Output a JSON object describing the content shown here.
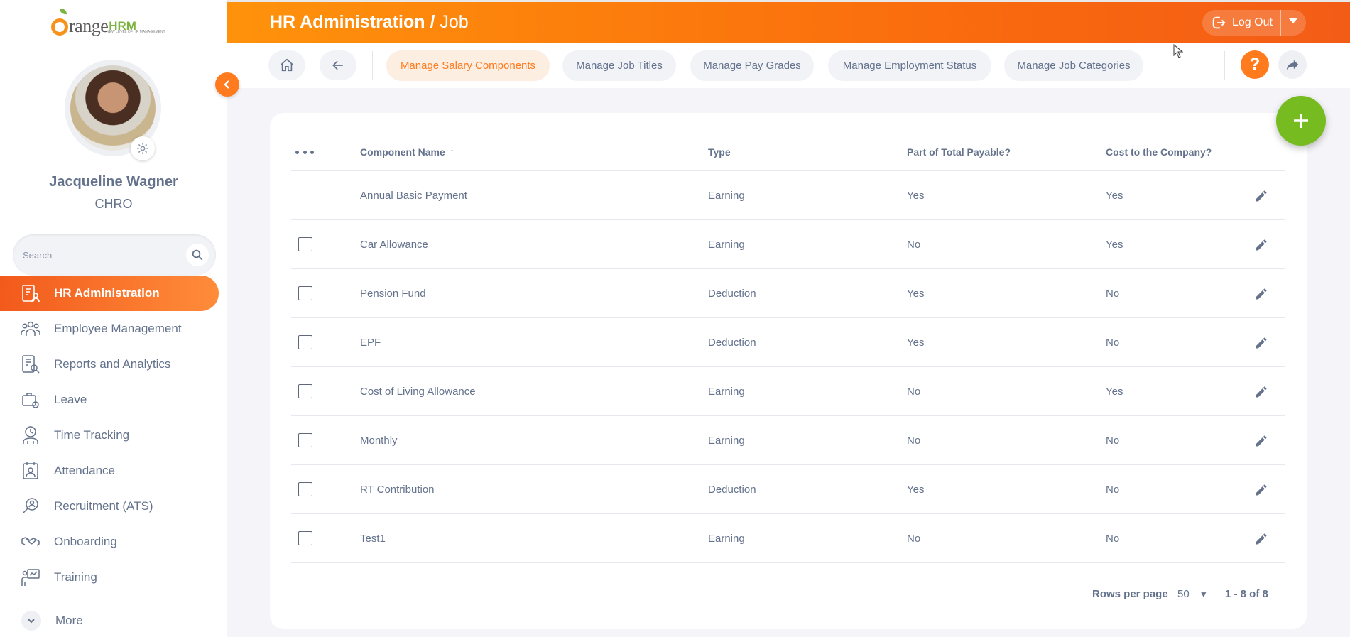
{
  "brand": {
    "logo_orange": "range",
    "logo_hrm": "HRM",
    "tagline": "NEW LEVEL OF HR MANAGEMENT"
  },
  "user": {
    "name": "Jacqueline Wagner",
    "role": "CHRO"
  },
  "search": {
    "placeholder": "Search"
  },
  "nav": {
    "items": [
      {
        "label": "HR Administration",
        "icon": "hr-admin-icon",
        "active": true
      },
      {
        "label": "Employee Management",
        "icon": "employee-icon"
      },
      {
        "label": "Reports and Analytics",
        "icon": "reports-icon"
      },
      {
        "label": "Leave",
        "icon": "leave-icon"
      },
      {
        "label": "Time Tracking",
        "icon": "time-tracking-icon"
      },
      {
        "label": "Attendance",
        "icon": "attendance-icon"
      },
      {
        "label": "Recruitment (ATS)",
        "icon": "recruitment-icon"
      },
      {
        "label": "Onboarding",
        "icon": "onboarding-icon"
      },
      {
        "label": "Training",
        "icon": "training-icon"
      }
    ],
    "more": "More"
  },
  "header": {
    "title_main": "HR Administration / ",
    "title_sub": "Job",
    "logout": "Log Out"
  },
  "tabs": [
    {
      "label": "Manage Salary Components",
      "active": true
    },
    {
      "label": "Manage Job Titles"
    },
    {
      "label": "Manage Pay Grades"
    },
    {
      "label": "Manage Employment Status"
    },
    {
      "label": "Manage Job Categories"
    }
  ],
  "help": "?",
  "table": {
    "columns": [
      "Component Name",
      "Type",
      "Part of Total Payable?",
      "Cost to the Company?"
    ],
    "sort_indicator": "↑",
    "rows": [
      {
        "name": "Annual Basic Payment",
        "type": "Earning",
        "payable": "Yes",
        "ctc": "Yes",
        "checkbox": false
      },
      {
        "name": "Car Allowance",
        "type": "Earning",
        "payable": "No",
        "ctc": "Yes",
        "checkbox": true
      },
      {
        "name": "Pension Fund",
        "type": "Deduction",
        "payable": "Yes",
        "ctc": "No",
        "checkbox": true
      },
      {
        "name": "EPF",
        "type": "Deduction",
        "payable": "Yes",
        "ctc": "No",
        "checkbox": true
      },
      {
        "name": "Cost of Living Allowance",
        "type": "Earning",
        "payable": "No",
        "ctc": "Yes",
        "checkbox": true
      },
      {
        "name": "Monthly",
        "type": "Earning",
        "payable": "No",
        "ctc": "No",
        "checkbox": true
      },
      {
        "name": "RT Contribution",
        "type": "Deduction",
        "payable": "Yes",
        "ctc": "No",
        "checkbox": true
      },
      {
        "name": "Test1",
        "type": "Earning",
        "payable": "No",
        "ctc": "No",
        "checkbox": true
      }
    ]
  },
  "pagination": {
    "rows_per_page_label": "Rows per page",
    "rows_per_page": "50",
    "range": "1 - 8 of 8"
  },
  "colors": {
    "accent": "#ff7b1d",
    "add": "#76bc21",
    "text": "#64728c"
  }
}
